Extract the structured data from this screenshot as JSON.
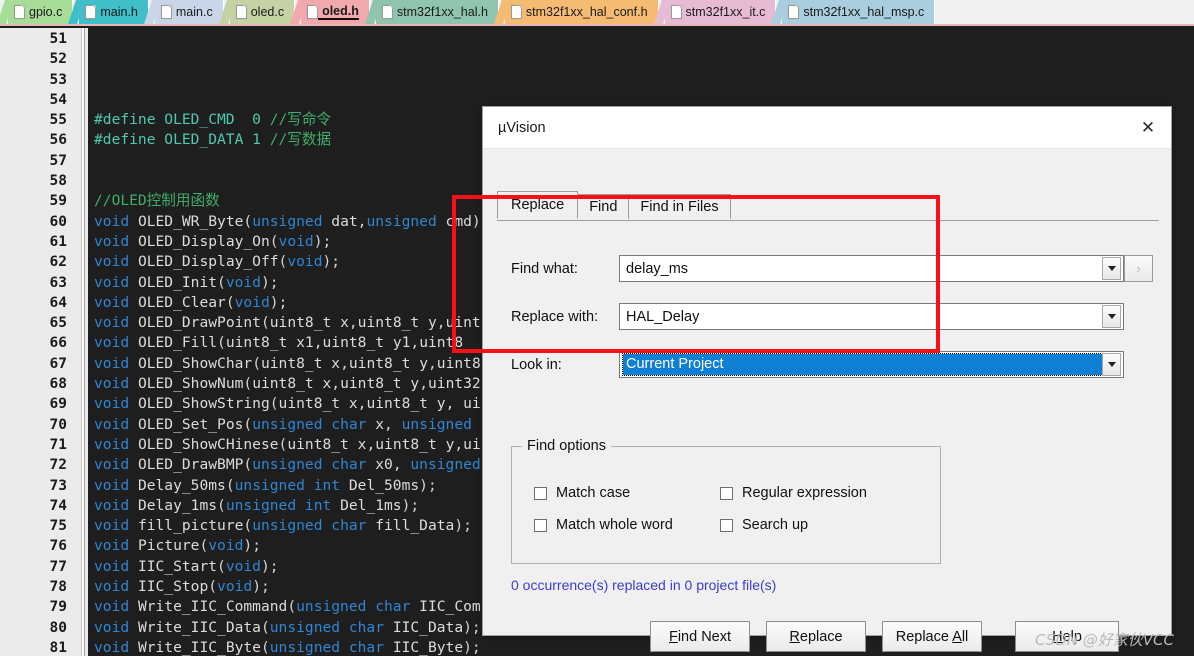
{
  "tabs": [
    {
      "label": "gpio.c",
      "color": "#a8dd97",
      "active": false
    },
    {
      "label": "main.h",
      "color": "#3fc0c9",
      "active": false
    },
    {
      "label": "main.c",
      "color": "#c9d6ea",
      "active": false
    },
    {
      "label": "oled.c",
      "color": "#c5d2a4",
      "active": false
    },
    {
      "label": "oled.h",
      "color": "#f2a9ae",
      "active": true
    },
    {
      "label": "stm32f1xx_hal.h",
      "color": "#8fc5ae",
      "active": false
    },
    {
      "label": "stm32f1xx_hal_conf.h",
      "color": "#f5bb72",
      "active": false
    },
    {
      "label": "stm32f1xx_it.c",
      "color": "#e7bbd3",
      "active": false
    },
    {
      "label": "stm32f1xx_hal_msp.c",
      "color": "#a9cfde",
      "active": false
    }
  ],
  "editor": {
    "first_line": 51,
    "lines": [
      {
        "n": 51,
        "html": ""
      },
      {
        "n": 52,
        "html": ""
      },
      {
        "n": 53,
        "html": ""
      },
      {
        "n": 54,
        "html": ""
      },
      {
        "n": 55,
        "html": "<span class='pp'>#define OLED_CMD  0 </span><span class='cmg'>//写命令</span>"
      },
      {
        "n": 56,
        "html": "<span class='pp'>#define OLED_DATA 1 </span><span class='cmg'>//写数据</span>"
      },
      {
        "n": 57,
        "html": ""
      },
      {
        "n": 58,
        "html": ""
      },
      {
        "n": 59,
        "html": "<span class='cmg'>//OLED控制用函数</span>"
      },
      {
        "n": 60,
        "html": "<span class='k'>void</span> <span class='id'>OLED_WR_Byte</span>(<span class='k'>unsigned</span> <span class='id'>dat</span>,<span class='k'>unsigned</span> <span class='id'>cmd</span>)"
      },
      {
        "n": 61,
        "html": "<span class='k'>void</span> <span class='id'>OLED_Display_On</span>(<span class='k'>void</span>);"
      },
      {
        "n": 62,
        "html": "<span class='k'>void</span> <span class='id'>OLED_Display_Off</span>(<span class='k'>void</span>);"
      },
      {
        "n": 63,
        "html": "<span class='k'>void</span> <span class='id'>OLED_Init</span>(<span class='k'>void</span>);"
      },
      {
        "n": 64,
        "html": "<span class='k'>void</span> <span class='id'>OLED_Clear</span>(<span class='k'>void</span>);"
      },
      {
        "n": 65,
        "html": "<span class='k'>void</span> <span class='id'>OLED_DrawPoint</span>(<span class='id'>uint8_t</span> <span class='id'>x</span>,<span class='id'>uint8_t</span> <span class='id'>y</span>,<span class='id'>uint</span>"
      },
      {
        "n": 66,
        "html": "<span class='k'>void</span> <span class='id'>OLED_Fill</span>(<span class='id'>uint8_t</span> <span class='id'>x1</span>,<span class='id'>uint8_t</span> <span class='id'>y1</span>,<span class='id'>uint8_</span>"
      },
      {
        "n": 67,
        "html": "<span class='k'>void</span> <span class='id'>OLED_ShowChar</span>(<span class='id'>uint8_t</span> <span class='id'>x</span>,<span class='id'>uint8_t</span> <span class='id'>y</span>,<span class='id'>uint8</span>"
      },
      {
        "n": 68,
        "html": "<span class='k'>void</span> <span class='id'>OLED_ShowNum</span>(<span class='id'>uint8_t</span> <span class='id'>x</span>,<span class='id'>uint8_t</span> <span class='id'>y</span>,<span class='id'>uint32</span>"
      },
      {
        "n": 69,
        "html": "<span class='k'>void</span> <span class='id'>OLED_ShowString</span>(<span class='id'>uint8_t</span> <span class='id'>x</span>,<span class='id'>uint8_t</span> <span class='id'>y</span>, <span class='id'>ui</span>"
      },
      {
        "n": 70,
        "html": "<span class='k'>void</span> <span class='id'>OLED_Set_Pos</span>(<span class='k'>unsigned</span> <span class='k'>char</span> <span class='id'>x</span>, <span class='k'>unsigned</span>"
      },
      {
        "n": 71,
        "html": "<span class='k'>void</span> <span class='id'>OLED_ShowCHinese</span>(<span class='id'>uint8_t</span> <span class='id'>x</span>,<span class='id'>uint8_t</span> <span class='id'>y</span>,<span class='id'>ui</span>"
      },
      {
        "n": 72,
        "html": "<span class='k'>void</span> <span class='id'>OLED_DrawBMP</span>(<span class='k'>unsigned</span> <span class='k'>char</span> <span class='id'>x0</span>, <span class='k'>unsigned</span>"
      },
      {
        "n": 73,
        "html": "<span class='k'>void</span> <span class='id'>Delay_50ms</span>(<span class='k'>unsigned</span> <span class='k'>int</span> <span class='id'>Del_50ms</span>);"
      },
      {
        "n": 74,
        "html": "<span class='k'>void</span> <span class='id'>Delay_1ms</span>(<span class='k'>unsigned</span> <span class='k'>int</span> <span class='id'>Del_1ms</span>);"
      },
      {
        "n": 75,
        "html": "<span class='k'>void</span> <span class='id'>fill_picture</span>(<span class='k'>unsigned</span> <span class='k'>char</span> <span class='id'>fill_Data</span>);"
      },
      {
        "n": 76,
        "html": "<span class='k'>void</span> <span class='id'>Picture</span>(<span class='k'>void</span>);"
      },
      {
        "n": 77,
        "html": "<span class='k'>void</span> <span class='id'>IIC_Start</span>(<span class='k'>void</span>);"
      },
      {
        "n": 78,
        "html": "<span class='k'>void</span> <span class='id'>IIC_Stop</span>(<span class='k'>void</span>);"
      },
      {
        "n": 79,
        "html": "<span class='k'>void</span> <span class='id'>Write_IIC_Command</span>(<span class='k'>unsigned</span> <span class='k'>char</span> <span class='id'>IIC_Com</span>"
      },
      {
        "n": 80,
        "html": "<span class='k'>void</span> <span class='id'>Write_IIC_Data</span>(<span class='k'>unsigned</span> <span class='k'>char</span> <span class='id'>IIC_Data</span>);"
      },
      {
        "n": 81,
        "html": "<span class='k'>void</span> <span class='id'>Write_IIC_Byte</span>(<span class='k'>unsigned</span> <span class='k'>char</span> <span class='id'>IIC_Byte</span>);"
      }
    ]
  },
  "dialog": {
    "title": "µVision",
    "close_label": "✕",
    "tabs": [
      {
        "label": "Replace",
        "selected": true
      },
      {
        "label": "Find",
        "selected": false
      },
      {
        "label": "Find in Files",
        "selected": false
      }
    ],
    "fields": {
      "find_label": "Find what:",
      "find_value": "delay_ms",
      "replace_label": "Replace with:",
      "replace_value": "HAL_Delay",
      "lookin_label": "Look in:",
      "lookin_value": "Current Project"
    },
    "browse_button": "›",
    "find_options": {
      "group_label": "Find options",
      "items": [
        {
          "label": "Match case",
          "checked": false
        },
        {
          "label": "Regular expression",
          "checked": false
        },
        {
          "label": "Match whole word",
          "checked": false
        },
        {
          "label": "Search up",
          "checked": false
        }
      ]
    },
    "status": "0 occurrence(s) replaced in 0 project file(s)",
    "status_color": "#3b3bd0",
    "buttons": [
      {
        "pre": "",
        "accel": "F",
        "post": "ind Next"
      },
      {
        "pre": "",
        "accel": "R",
        "post": "eplace"
      },
      {
        "pre": "Replace ",
        "accel": "A",
        "post": "ll"
      },
      {
        "pre": "",
        "accel": "H",
        "post": "elp"
      }
    ]
  },
  "annotation": {
    "color": "#fa0f19"
  },
  "watermark": "CSDN @好家伙VCC"
}
